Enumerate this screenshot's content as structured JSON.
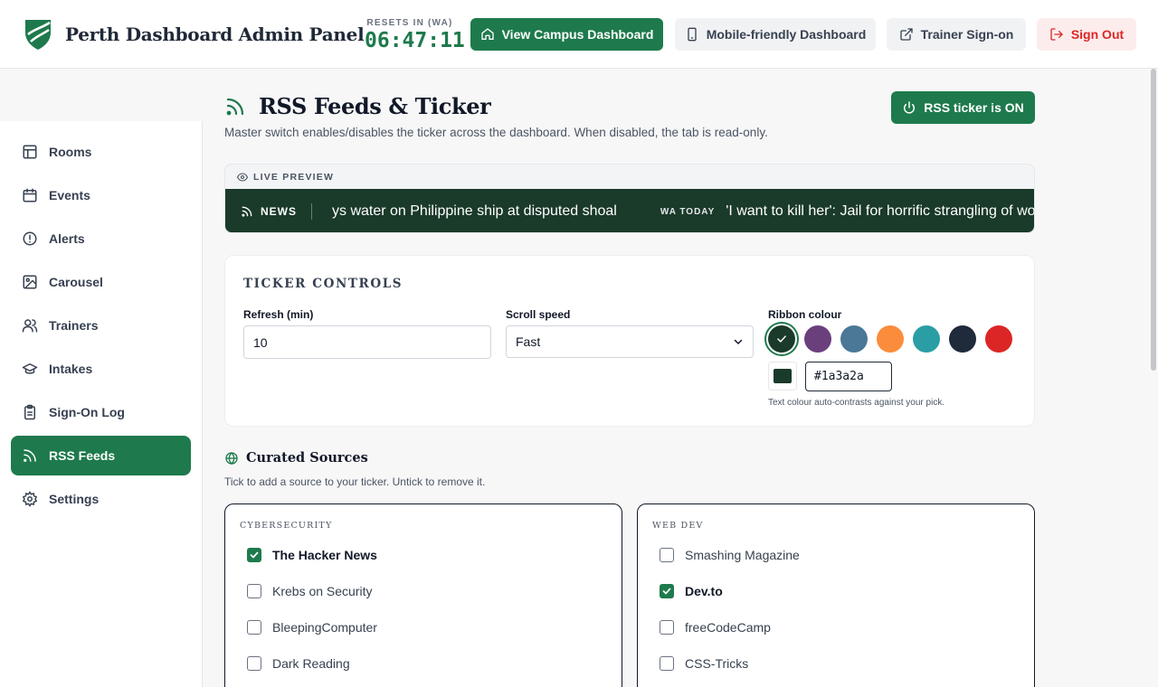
{
  "header": {
    "title": "Perth Dashboard Admin Panel",
    "reset_label": "RESETS IN (WA)",
    "reset_time": "06:47:11",
    "buttons": {
      "campus": "View Campus Dashboard",
      "mobile": "Mobile-friendly Dashboard",
      "trainer": "Trainer Sign-on",
      "signout": "Sign Out"
    }
  },
  "sidebar": {
    "items": [
      {
        "label": "Rooms",
        "icon": "layout-icon"
      },
      {
        "label": "Events",
        "icon": "calendar-icon"
      },
      {
        "label": "Alerts",
        "icon": "alert-circle-icon"
      },
      {
        "label": "Carousel",
        "icon": "image-icon"
      },
      {
        "label": "Trainers",
        "icon": "users-icon"
      },
      {
        "label": "Intakes",
        "icon": "graduation-cap-icon"
      },
      {
        "label": "Sign-On Log",
        "icon": "clipboard-icon"
      },
      {
        "label": "RSS Feeds",
        "icon": "rss-icon",
        "active": true
      },
      {
        "label": "Settings",
        "icon": "gear-icon"
      }
    ]
  },
  "main": {
    "title": "RSS Feeds & Ticker",
    "subtitle": "Master switch enables/disables the ticker across the dashboard. When disabled, the tab is read-only.",
    "toggle_label": "RSS ticker is ON",
    "preview": {
      "label": "LIVE PREVIEW",
      "badge": "NEWS",
      "headline1": "ys water on Philippine ship at disputed shoal",
      "source2": "WA TODAY",
      "headline2": "'I want to kill her': Jail for horrific strangling of wo"
    },
    "controls": {
      "title": "TICKER CONTROLS",
      "refresh_label": "Refresh (min)",
      "refresh_value": "10",
      "speed_label": "Scroll speed",
      "speed_value": "Fast",
      "ribbon_label": "Ribbon colour",
      "swatches": [
        "#1a3a2a",
        "#6b3f7c",
        "#4a7896",
        "#fb8c3c",
        "#2a9ea4",
        "#1f2a3a",
        "#dc2626"
      ],
      "selected_swatch": 0,
      "hex_value": "#1a3a2a",
      "hint": "Text colour auto-contrasts against your pick."
    },
    "curated": {
      "title": "Curated Sources",
      "subtitle": "Tick to add a source to your ticker. Untick to remove it.",
      "groups": [
        {
          "name": "CYBERSECURITY",
          "sources": [
            {
              "label": "The Hacker News",
              "checked": true
            },
            {
              "label": "Krebs on Security",
              "checked": false
            },
            {
              "label": "BleepingComputer",
              "checked": false
            },
            {
              "label": "Dark Reading",
              "checked": false
            }
          ]
        },
        {
          "name": "WEB DEV",
          "sources": [
            {
              "label": "Smashing Magazine",
              "checked": false
            },
            {
              "label": "Dev.to",
              "checked": true
            },
            {
              "label": "freeCodeCamp",
              "checked": false
            },
            {
              "label": "CSS-Tricks",
              "checked": false
            }
          ]
        }
      ]
    }
  },
  "colors": {
    "accent": "#1e7a4c",
    "danger": "#dc2626",
    "ticker_bg": "#1a3a2a"
  }
}
